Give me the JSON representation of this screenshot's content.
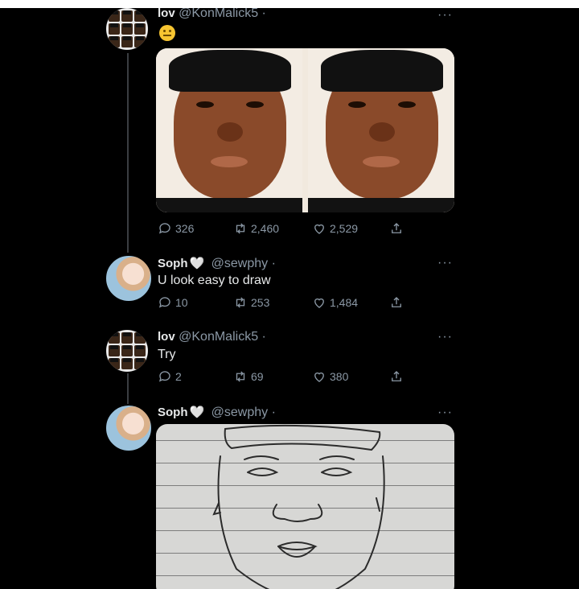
{
  "colors": {
    "background": "#000000",
    "text": "#e7e9ea",
    "muted": "#8b98a5",
    "thread_line": "#3a3d41"
  },
  "thread": [
    {
      "name": "lov",
      "handle": "@KonMalick5 ·",
      "body": "",
      "emoji": "neutral-face-emoji",
      "media": "two-portrait-photos",
      "stats": {
        "replies": "326",
        "retweets": "2,460",
        "likes": "2,529"
      }
    },
    {
      "name": "Soph",
      "name_suffix_icon": "white-heart-icon",
      "handle": "@sewphy ·",
      "body": "U look easy to draw",
      "stats": {
        "replies": "10",
        "retweets": "253",
        "likes": "1,484"
      }
    },
    {
      "name": "lov",
      "handle": "@KonMalick5 ·",
      "body": "Try",
      "stats": {
        "replies": "2",
        "retweets": "69",
        "likes": "380"
      }
    },
    {
      "name": "Soph",
      "name_suffix_icon": "white-heart-icon",
      "handle": "@sewphy ·",
      "media": "pencil-sketch-on-lined-paper"
    }
  ],
  "more_label": "···",
  "heart_glyph": "🤍"
}
